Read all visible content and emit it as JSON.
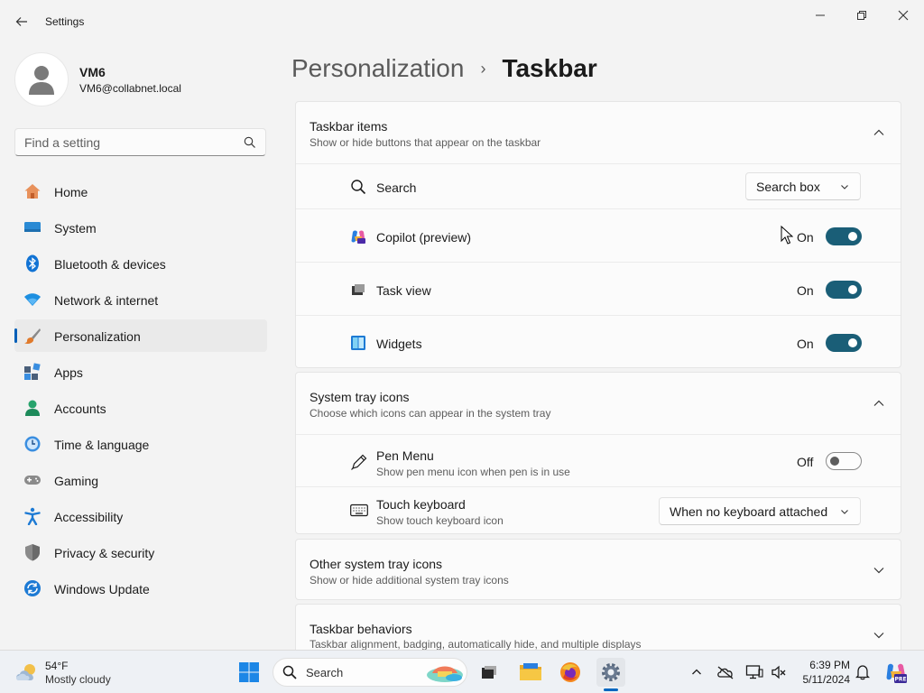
{
  "window": {
    "title": "Settings"
  },
  "profile": {
    "name": "VM6",
    "email": "VM6@collabnet.local"
  },
  "search": {
    "placeholder": "Find a setting"
  },
  "nav": {
    "items": [
      {
        "label": "Home",
        "icon": "home-icon",
        "active": false
      },
      {
        "label": "System",
        "icon": "system-icon",
        "active": false
      },
      {
        "label": "Bluetooth & devices",
        "icon": "bluetooth-icon",
        "active": false
      },
      {
        "label": "Network & internet",
        "icon": "network-icon",
        "active": false
      },
      {
        "label": "Personalization",
        "icon": "paintbrush-icon",
        "active": true
      },
      {
        "label": "Apps",
        "icon": "apps-icon",
        "active": false
      },
      {
        "label": "Accounts",
        "icon": "accounts-icon",
        "active": false
      },
      {
        "label": "Time & language",
        "icon": "time-language-icon",
        "active": false
      },
      {
        "label": "Gaming",
        "icon": "gaming-icon",
        "active": false
      },
      {
        "label": "Accessibility",
        "icon": "accessibility-icon",
        "active": false
      },
      {
        "label": "Privacy & security",
        "icon": "shield-icon",
        "active": false
      },
      {
        "label": "Windows Update",
        "icon": "update-icon",
        "active": false
      }
    ]
  },
  "breadcrumb": {
    "parent": "Personalization",
    "separator": "›",
    "current": "Taskbar"
  },
  "taskbar_items": {
    "title": "Taskbar items",
    "subtitle": "Show or hide buttons that appear on the taskbar",
    "search": {
      "label": "Search",
      "value": "Search box"
    },
    "copilot": {
      "label": "Copilot (preview)",
      "state": "On"
    },
    "task_view": {
      "label": "Task view",
      "state": "On"
    },
    "widgets": {
      "label": "Widgets",
      "state": "On"
    }
  },
  "system_tray": {
    "title": "System tray icons",
    "subtitle": "Choose which icons can appear in the system tray",
    "pen_menu": {
      "label": "Pen Menu",
      "sub": "Show pen menu icon when pen is in use",
      "state": "Off"
    },
    "touch_keyboard": {
      "label": "Touch keyboard",
      "sub": "Show touch keyboard icon",
      "value": "When no keyboard attached"
    }
  },
  "other_tray": {
    "title": "Other system tray icons",
    "subtitle": "Show or hide additional system tray icons"
  },
  "behaviors": {
    "title": "Taskbar behaviors",
    "subtitle": "Taskbar alignment, badging, automatically hide, and multiple displays"
  },
  "taskbar": {
    "weather_temp": "54°F",
    "weather_cond": "Mostly cloudy",
    "search_label": "Search",
    "time": "6:39 PM",
    "date": "5/11/2024"
  },
  "colors": {
    "accent": "#005fb8",
    "toggle_on": "#1a5e77"
  }
}
